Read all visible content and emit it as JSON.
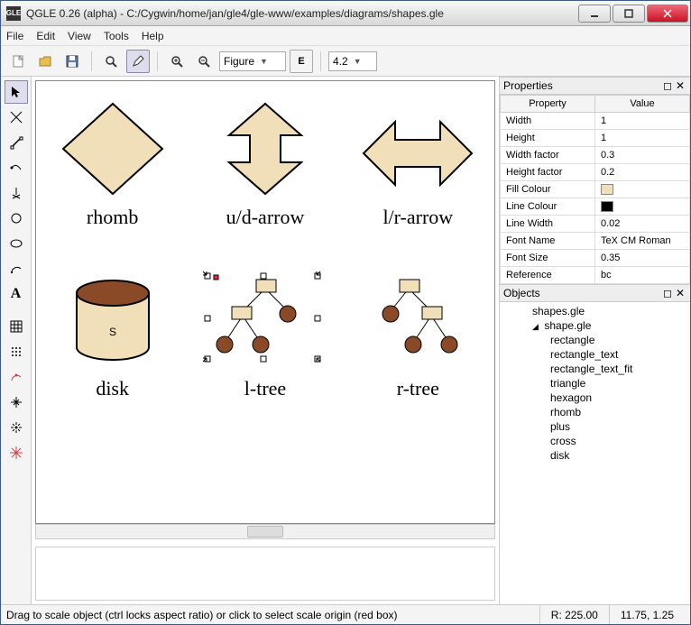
{
  "window": {
    "app_icon_text": "GLE",
    "title": "QGLE 0.26 (alpha) - C:/Cygwin/home/jan/gle4/gle-www/examples/diagrams/shapes.gle"
  },
  "menu": {
    "file": "File",
    "edit": "Edit",
    "view": "View",
    "tools": "Tools",
    "help": "Help"
  },
  "toolbar": {
    "combo1": "Figure",
    "combo2": "4.2"
  },
  "shapes": {
    "r1": [
      "rhomb",
      "u/d-arrow",
      "l/r-arrow"
    ],
    "r2": [
      "disk",
      "l-tree",
      "r-tree"
    ],
    "disk_letter": "S"
  },
  "panes": {
    "properties_title": "Properties",
    "prop_hdr_key": "Property",
    "prop_hdr_val": "Value",
    "rows": [
      {
        "k": "Width",
        "v": "1"
      },
      {
        "k": "Height",
        "v": "1"
      },
      {
        "k": "Width factor",
        "v": "0.3"
      },
      {
        "k": "Height factor",
        "v": "0.2"
      },
      {
        "k": "Fill Colour",
        "v": "",
        "sw": "#f0dfb8"
      },
      {
        "k": "Line Colour",
        "v": "",
        "sw": "#000000"
      },
      {
        "k": "Line Width",
        "v": "0.02"
      },
      {
        "k": "Font Name",
        "v": "TeX CM Roman"
      },
      {
        "k": "Font Size",
        "v": "0.35"
      },
      {
        "k": "Reference",
        "v": "bc"
      }
    ],
    "objects_title": "Objects",
    "objects": {
      "root": "shapes.gle",
      "child": "shape.gle",
      "items": [
        "rectangle",
        "rectangle_text",
        "rectangle_text_fit",
        "triangle",
        "hexagon",
        "rhomb",
        "plus",
        "cross",
        "disk"
      ]
    }
  },
  "status": {
    "msg": "Drag to scale object (ctrl locks aspect ratio) or click to select scale origin (red box)",
    "r": "R:  225.00",
    "xy": "11.75, 1.25"
  },
  "colors": {
    "fill": "#f0dfb8",
    "dark": "#8a4a27"
  }
}
